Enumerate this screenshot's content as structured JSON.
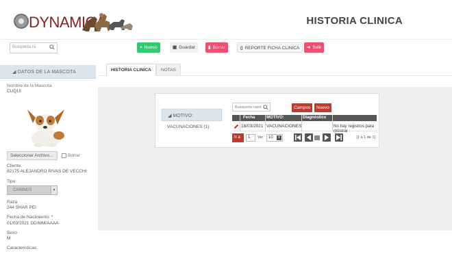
{
  "header": {
    "logo_text": "DYNAMICA",
    "page_title": "HISTORIA CLINICA"
  },
  "toolbar": {
    "nuevo": "Nuevo",
    "guardar": "Guardar",
    "borrar": "Borrar",
    "reporte": "REPORTE FICHA CLINICA",
    "salir": "Salir"
  },
  "left": {
    "search_placeholder": "Busqueda rá",
    "section_title": "DATOS DE LA MASCOTA",
    "nombre_label": "Nombre de la Mascota",
    "nombre_value": "CUQUI",
    "select_file_label": "Seleccionar Archivo...",
    "borrar_label": "Borrar",
    "cliente_label": "Cliente:",
    "cliente_value": "82175 ALEJANDRO RIVAS DE VECCHI",
    "tipo_label": "Tipo",
    "tipo_value": "CANINOS",
    "raza_label": "Raza",
    "raza_value": "244 SHAR PEI",
    "fecha_nac_label": "Fecha de Naciiniento:",
    "fecha_nac_required": "*",
    "fecha_nac_value": "01/03/2021 DD/MM/AAAA",
    "sexo_label": "Sexo",
    "sexo_value": "M",
    "caracteristicas_label": "Caracteristicas:"
  },
  "tabs": [
    {
      "label": "HISTORIA CLINICA",
      "active": true
    },
    {
      "label": "NOTAS",
      "active": false
    }
  ],
  "motivo": {
    "header": "MOTIVO:",
    "items": [
      "VACUNACIONES (1)"
    ]
  },
  "grid": {
    "search_placeholder": "Busqueda rapid",
    "campos_btn": "Campos",
    "nuevo_btn": "Nuevo",
    "columns": [
      "Fecha",
      "MOTIVO:",
      "Diagnóstico"
    ],
    "rows": [
      {
        "fecha": "18/03/2021",
        "motivo": "VACUNACIONES",
        "diagnostico": ""
      }
    ],
    "empty_message": "No hay registros para mostrar",
    "pager": {
      "go_label": "Ir a",
      "page_value": "1",
      "ver_label": "Ver",
      "per_page": "10",
      "count_label": "[1 a 1 de 1]"
    }
  },
  "colors": {
    "brand_red": "#8a1f1f",
    "accent_green": "#2ecc71",
    "accent_pink": "#ef4f6e",
    "grid_red": "#c0392b",
    "section_blue": "#dce6ef"
  }
}
